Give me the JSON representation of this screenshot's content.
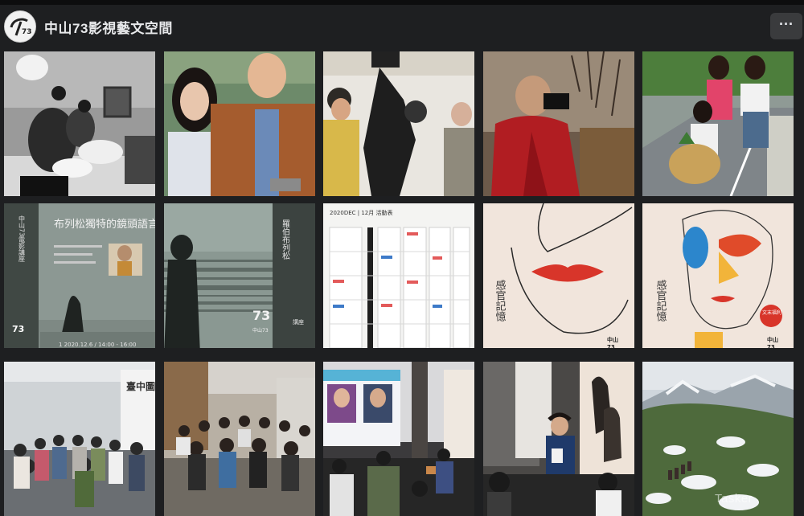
{
  "page": {
    "name": "中山73影視藝文空間",
    "more_button": "···",
    "logo_text": "73"
  },
  "photos": [
    {
      "id": "p1",
      "alt": "pillow-fight-photo"
    },
    {
      "id": "p2",
      "alt": "couple-portrait-photo"
    },
    {
      "id": "p3",
      "alt": "film-camera-crew-photo"
    },
    {
      "id": "p4",
      "alt": "monk-with-camera-photo"
    },
    {
      "id": "p5",
      "alt": "kids-with-basket-photo"
    }
  ],
  "poster_lecture": {
    "vertical_title": "中山73電影講座",
    "title": "布列松獨特的鏡頭語言",
    "footer": "1 2020.12.6 / 14:00 - 16:00"
  },
  "poster_bresson": {
    "vertical_title": "羅伯布列松",
    "logo_text": "73",
    "logo_sub": "中山73",
    "tag": "講座"
  },
  "calendar": {
    "header": "2020DEC | 12月 活動表"
  },
  "poster_senses_1": {
    "vertical_text": "感官記憶",
    "logo_text": "中山",
    "logo_num": "73"
  },
  "poster_senses_2": {
    "vertical_text": "感官記憶",
    "badge": "文末福利",
    "logo_text": "中山",
    "logo_num": "73"
  },
  "event_photos": [
    {
      "id": "e1",
      "alt": "audience-room-photo",
      "banner": "臺中圖"
    },
    {
      "id": "e2",
      "alt": "audience-seated-photo"
    },
    {
      "id": "e3",
      "alt": "screen-presentation-photo"
    },
    {
      "id": "e4",
      "alt": "speaker-standing-photo"
    },
    {
      "id": "e5",
      "alt": "snowy-mountain-photo"
    }
  ],
  "watermark": "Tasker"
}
